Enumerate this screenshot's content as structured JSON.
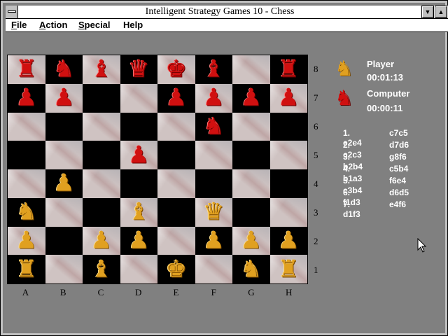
{
  "window": {
    "title": "Intelligent Strategy Games 10 - Chess",
    "minimize_glyph": "▼",
    "maximize_glyph": "▲"
  },
  "menu": {
    "items": [
      {
        "label": "File",
        "accel": "F",
        "rest": "ile"
      },
      {
        "label": "Action",
        "accel": "A",
        "rest": "ction"
      },
      {
        "label": "Special",
        "accel": "S",
        "rest": "pecial"
      },
      {
        "label": "Help",
        "accel": "",
        "rest": "Help"
      }
    ]
  },
  "board": {
    "ranks": [
      "8",
      "7",
      "6",
      "5",
      "4",
      "3",
      "2",
      "1"
    ],
    "files": [
      "A",
      "B",
      "C",
      "D",
      "E",
      "F",
      "G",
      "H"
    ],
    "squares": [
      [
        "rR",
        "rN",
        "rB",
        "rQ",
        "rK",
        "rB",
        "",
        "rR"
      ],
      [
        "rP",
        "rP",
        "",
        "",
        "rP",
        "rP",
        "rP",
        "rP"
      ],
      [
        "",
        "",
        "",
        "",
        "",
        "rN",
        "",
        ""
      ],
      [
        "",
        "",
        "",
        "rP",
        "",
        "",
        "",
        ""
      ],
      [
        "",
        "gP",
        "",
        "",
        "",
        "",
        "",
        ""
      ],
      [
        "gN",
        "",
        "",
        "gB",
        "",
        "gQ",
        "",
        ""
      ],
      [
        "gP",
        "",
        "gP",
        "gP",
        "",
        "gP",
        "gP",
        "gP"
      ],
      [
        "gR",
        "",
        "gB",
        "",
        "gK",
        "",
        "gN",
        "gR"
      ]
    ],
    "colors": {
      "red": "#d01010",
      "gold": "#e0a020"
    }
  },
  "players": {
    "player": {
      "name": "Player",
      "time": "00:01:13",
      "icon": "gold-knight-icon"
    },
    "computer": {
      "name": "Computer",
      "time": "00:00:11",
      "icon": "red-knight-icon"
    }
  },
  "moves": [
    {
      "white": "1. e2e4",
      "black": "c7c5"
    },
    {
      "white": "2. c2c3",
      "black": "d7d6"
    },
    {
      "white": "3. b2b4",
      "black": "g8f6"
    },
    {
      "white": "4. b1a3",
      "black": "c5b4"
    },
    {
      "white": "5. c3b4",
      "black": "f6e4"
    },
    {
      "white": "6. f1d3",
      "black": "d6d5"
    },
    {
      "white": "7. d1f3",
      "black": "e4f6"
    }
  ]
}
